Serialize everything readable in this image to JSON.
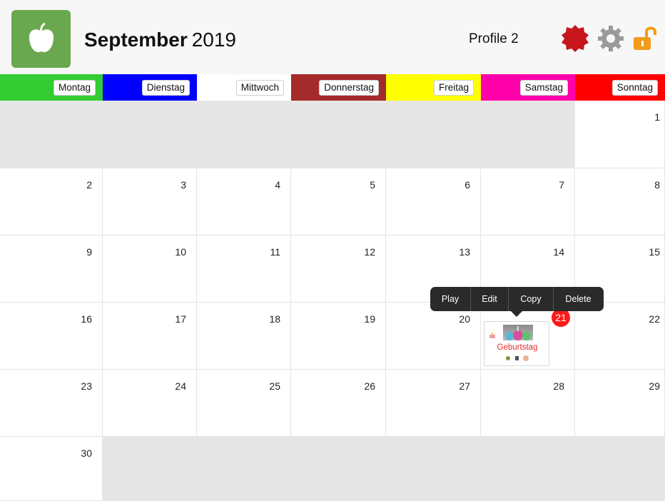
{
  "header": {
    "month": "September",
    "year": "2019",
    "profile": "Profile 2",
    "icons": [
      "apple-icon",
      "red-badge-icon",
      "gear-icon",
      "unlocked-padlock-icon"
    ],
    "colors": {
      "app_icon_bg": "#6aa84f",
      "badge": "#c8161d",
      "padlock": "#f29c1c"
    }
  },
  "weekdays": [
    {
      "label": "Montag",
      "color": "#33cc33"
    },
    {
      "label": "Dienstag",
      "color": "#0000ff"
    },
    {
      "label": "Mittwoch",
      "color": "#ffffff"
    },
    {
      "label": "Donnerstag",
      "color": "#a52a2a"
    },
    {
      "label": "Freitag",
      "color": "#ffff00"
    },
    {
      "label": "Samstag",
      "color": "#ff00aa"
    },
    {
      "label": "Sonntag",
      "color": "#ff0000"
    }
  ],
  "weeks": [
    [
      "",
      "",
      "",
      "",
      "",
      "",
      "1"
    ],
    [
      "2",
      "3",
      "4",
      "5",
      "6",
      "7",
      "8"
    ],
    [
      "9",
      "10",
      "11",
      "12",
      "13",
      "14",
      "15"
    ],
    [
      "16",
      "17",
      "18",
      "19",
      "20",
      "21",
      "22"
    ],
    [
      "23",
      "24",
      "25",
      "26",
      "27",
      "28",
      "29"
    ],
    [
      "30",
      "",
      "",
      "",
      "",
      "",
      ""
    ]
  ],
  "today": "21",
  "event": {
    "title": "Geburtstag",
    "date": "21"
  },
  "popover": {
    "items": [
      "Play",
      "Edit",
      "Copy",
      "Delete"
    ]
  }
}
